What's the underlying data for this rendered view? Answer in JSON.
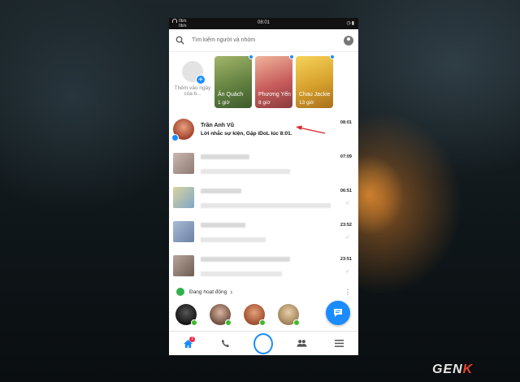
{
  "status_bar": {
    "network_top": "0b/s",
    "network_bottom": "0b/s",
    "time": "08:01"
  },
  "search": {
    "placeholder": "Tìm kiếm người và nhóm"
  },
  "stories": {
    "add_label": "Thêm vào ngày của b...",
    "items": [
      {
        "name": "Ân Quách",
        "time": "1 giờ",
        "color": "#6b8f4e"
      },
      {
        "name": "Phương Yến",
        "time": "8 giờ",
        "color": "#c85a5a"
      },
      {
        "name": "Chau Jackie",
        "time": "13 giờ",
        "color": "#d6a82c"
      }
    ]
  },
  "chats": [
    {
      "name": "Trần Anh Vũ",
      "message": "Lời nhắc sự kiện, Gặp iDoL lúc 8:01.",
      "time": "08:01"
    },
    {
      "name": "",
      "message": "",
      "time": "07:09"
    },
    {
      "name": "",
      "message": "",
      "time": "06:51"
    },
    {
      "name": "",
      "message": "",
      "time": "23:52"
    },
    {
      "name": "",
      "message": "",
      "time": "23:51"
    }
  ],
  "active": {
    "label": "Đang hoạt động"
  },
  "nav": {
    "home_badge": "1"
  },
  "watermark": {
    "brand": "GEN",
    "brand_accent": "K"
  },
  "colors": {
    "accent": "#1a8cff",
    "online": "#42b72a",
    "arrow": "#d9262c"
  }
}
